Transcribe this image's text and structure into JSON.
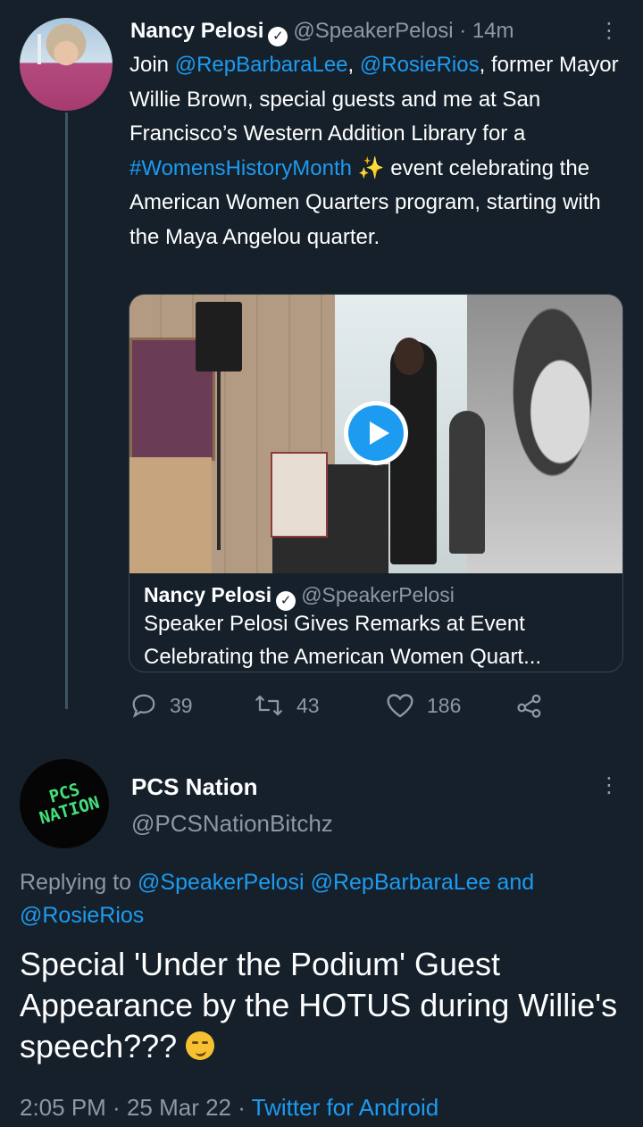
{
  "tweet": {
    "author_name": "Nancy Pelosi",
    "author_handle": "@SpeakerPelosi",
    "time_ago": "· 14m",
    "more_icon": "⋮",
    "text_parts": {
      "join": "Join ",
      "mention1": "@RepBarbaraLee",
      "comma1": ", ",
      "mention2": "@RosieRios",
      "rest1": ", former Mayor Willie Brown, special guests and me at San Francisco’s Western Addition Library for a ",
      "hashtag": "#WomensHistoryMonth",
      "rest2": " event celebrating the American Women Quarters program, starting with the Maya Angelou quarter."
    },
    "emoji_icon": "✨",
    "card": {
      "author_name": "Nancy Pelosi",
      "author_handle": "@SpeakerPelosi",
      "title_line1": "Speaker Pelosi Gives Remarks at Event",
      "title_line2": "Celebrating the American Women Quart..."
    },
    "actions": {
      "replies": "39",
      "retweets": "43",
      "likes": "186"
    }
  },
  "reply": {
    "author_name": "PCS Nation",
    "author_handle": "@PCSNationBitchz",
    "avatar_text": "PCS NATION",
    "more_icon": "⋮",
    "replying_prefix": "Replying to ",
    "replying_to1": "@SpeakerPelosi",
    "replying_to2": "@RepBarbaraLee",
    "replying_and": " and",
    "replying_to3": "@RosieRios",
    "text": "Special 'Under the Podium' Guest Appearance by the HOTUS during Willie's speech??? ",
    "emoji": "smirking-face",
    "time": "2:05 PM",
    "date": "25 Mar 22",
    "client": "Twitter for Android"
  },
  "colors": {
    "background": "#15202b",
    "link": "#1d9bf0",
    "secondary_text": "#8b98a5",
    "avatar_logo": "#44e07b"
  }
}
